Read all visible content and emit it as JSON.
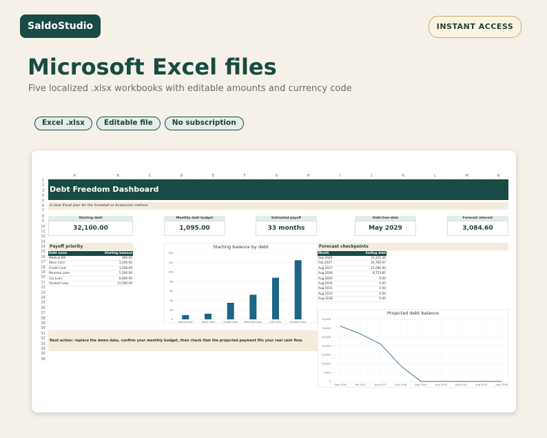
{
  "header": {
    "brand": "SaldoStudio",
    "cta": "INSTANT ACCESS"
  },
  "hero": {
    "title": "Microsoft Excel files",
    "subtitle": "Five localized .xlsx workbooks with editable amounts and currency code"
  },
  "pills": [
    "Excel .xlsx",
    "Editable file",
    "No subscription"
  ],
  "sheet": {
    "columns": [
      "A",
      "B",
      "C",
      "D",
      "E",
      "F",
      "G",
      "H",
      "I",
      "J",
      "K",
      "L",
      "M",
      "N"
    ],
    "rows": [
      "1",
      "2",
      "3",
      "4",
      "5",
      "6",
      "7",
      "8",
      "9",
      "10",
      "11",
      "12",
      "13",
      "14",
      "15",
      "16",
      "17",
      "18",
      "19",
      "20",
      "21",
      "22",
      "23",
      "24",
      "25",
      "26",
      "27",
      "28",
      "29",
      "30",
      "31",
      "32",
      "33",
      "34",
      "35",
      "36"
    ],
    "title": "Debt Freedom Dashboard",
    "description": "A clear Excel plan for the Snowball or Avalanche method",
    "kpis": [
      {
        "label": "Starting debt",
        "value": "32,100.00"
      },
      {
        "label": "Monthly debt budget",
        "value": "1,095.00"
      },
      {
        "label": "Estimated payoff",
        "value": "33 months"
      },
      {
        "label": "Debt-free date",
        "value": "May 2029"
      },
      {
        "label": "Forecast interest",
        "value": "3,084.60"
      }
    ],
    "payoff": {
      "section": "Payoff priority",
      "headers": [
        "Debt name",
        "Starting balance"
      ],
      "rows": [
        [
          "Medical Bill",
          "900.00"
        ],
        [
          "Store Card",
          "1,200.00"
        ],
        [
          "Credit Card",
          "3,500.00"
        ],
        [
          "Personal Loan",
          "5,200.00"
        ],
        [
          "Car Loan",
          "8,800.00"
        ],
        [
          "Student Loan",
          "12,500.00"
        ]
      ]
    },
    "forecast": {
      "section": "Forecast checkpoints",
      "headers": [
        "Month",
        "Ending debt"
      ],
      "rows": [
        [
          "Sep 2026",
          "31,225.36"
        ],
        [
          "Feb 2027",
          "26,760.07"
        ],
        [
          "Aug 2027",
          "21,060.40"
        ],
        [
          "Aug 2028",
          "8,753.81"
        ],
        [
          "Aug 2029",
          "0.00"
        ],
        [
          "Aug 2030",
          "0.00"
        ],
        [
          "Aug 2031",
          "0.00"
        ],
        [
          "Aug 2033",
          "0.00"
        ],
        [
          "Aug 2036",
          "0.00"
        ]
      ]
    },
    "next_action": "Next action: replace the demo data, confirm your monthly budget, then check that the projected payment fits your real cash flow."
  },
  "chart_data": [
    {
      "type": "bar",
      "title": "Starting balance by debt",
      "categories": [
        "Medical Bill",
        "Store Card",
        "Credit Card",
        "Personal Loan",
        "Car Loan",
        "Student Loan"
      ],
      "values": [
        900,
        1200,
        3500,
        5200,
        8800,
        12500
      ],
      "ylim": [
        0,
        14000
      ],
      "yticks": [
        "0",
        "2k",
        "4k",
        "6k",
        "8k",
        "10k",
        "12k",
        "14k"
      ],
      "color": "#1d6584"
    },
    {
      "type": "line",
      "title": "Projected debt balance",
      "x": [
        "Sep 2026",
        "Feb 2027",
        "Aug 2027",
        "Aug 2028",
        "Aug 2029",
        "Aug 2030",
        "Aug 2031",
        "Aug 2033",
        "Aug 2036"
      ],
      "values": [
        31225.36,
        26760.07,
        21060.4,
        8753.81,
        0,
        0,
        0,
        0,
        0
      ],
      "ylim": [
        0,
        35000
      ],
      "yticks": [
        "0",
        "5,000",
        "10,000",
        "15,000",
        "20,000",
        "25,000",
        "30,000",
        "35,000"
      ],
      "color": "#5b8aa3"
    }
  ]
}
